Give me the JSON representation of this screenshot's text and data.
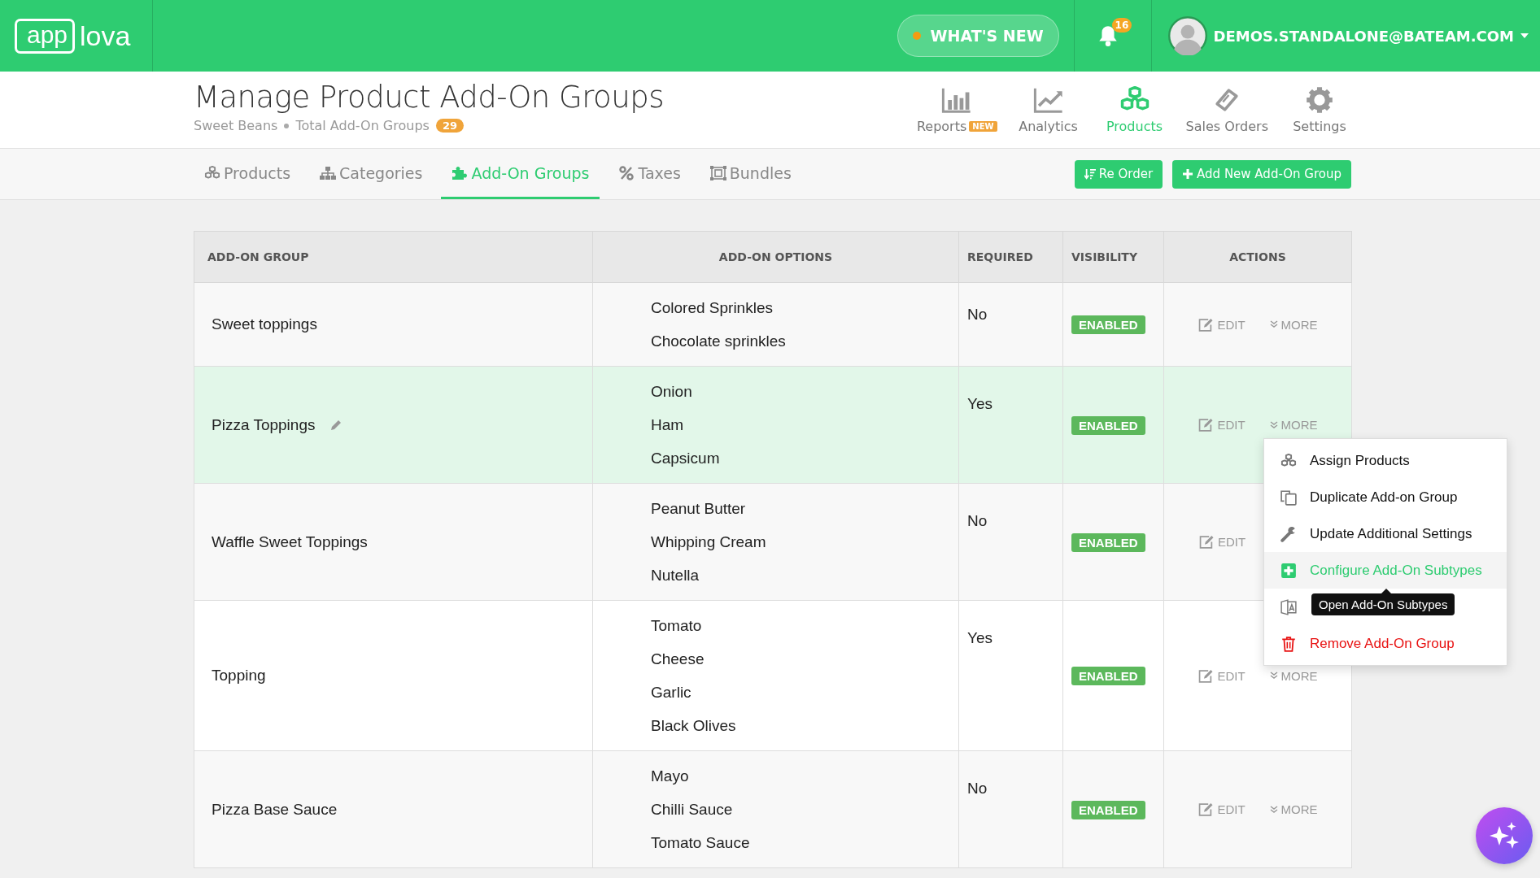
{
  "brand": {
    "left": "app",
    "right": "lova"
  },
  "topbar": {
    "whats_new": "WHAT'S NEW",
    "notifications": "16",
    "user": "DEMOS.STANDALONE@BATEAM.COM"
  },
  "page": {
    "title": "Manage Product Add-On Groups",
    "store": "Sweet Beans",
    "total_label": "Total Add-On Groups",
    "total": "29"
  },
  "modules": [
    {
      "label": "Reports",
      "badge": "NEW",
      "selected": false
    },
    {
      "label": "Analytics",
      "selected": false
    },
    {
      "label": "Products",
      "selected": true
    },
    {
      "label": "Sales Orders",
      "selected": false
    },
    {
      "label": "Settings",
      "selected": false
    }
  ],
  "tabs": [
    {
      "label": "Products",
      "selected": false
    },
    {
      "label": "Categories",
      "selected": false
    },
    {
      "label": "Add-On Groups",
      "selected": true
    },
    {
      "label": "Taxes",
      "selected": false
    },
    {
      "label": "Bundles",
      "selected": false
    }
  ],
  "actions": [
    "Re Order",
    "Add New Add-On Group"
  ],
  "table": {
    "columns": [
      "ADD-ON GROUP",
      "ADD-ON OPTIONS",
      "REQUIRED",
      "VISIBILITY",
      "ACTIONS"
    ],
    "rows": [
      {
        "group": "Sweet toppings",
        "options": [
          "Colored Sprinkles",
          "Chocolate sprinkles"
        ],
        "required": "No",
        "visibility": "ENABLED",
        "edit": "EDIT",
        "more": "MORE",
        "selected": false
      },
      {
        "group": "Pizza Toppings",
        "options": [
          "Onion",
          "Ham",
          "Capsicum"
        ],
        "required": "Yes",
        "visibility": "ENABLED",
        "edit": "EDIT",
        "more": "MORE",
        "selected": true
      },
      {
        "group": "Waffle Sweet Toppings",
        "options": [
          "Peanut Butter",
          "Whipping Cream",
          "Nutella"
        ],
        "required": "No",
        "visibility": "ENABLED",
        "edit": "EDIT",
        "selected": false
      },
      {
        "group": "Topping",
        "options": [
          "Tomato",
          "Cheese",
          "Garlic",
          "Black Olives"
        ],
        "required": "Yes",
        "visibility": "ENABLED",
        "edit": "EDIT",
        "more": "MORE",
        "selected": false
      },
      {
        "group": "Pizza Base Sauce",
        "options": [
          "Mayo",
          "Chilli Sauce",
          "Tomato Sauce"
        ],
        "required": "No",
        "visibility": "ENABLED",
        "edit": "EDIT",
        "more": "MORE",
        "selected": false
      }
    ]
  },
  "more_menu": {
    "items": [
      {
        "label": "Assign Products",
        "kind": "normal"
      },
      {
        "label": "Duplicate Add-on Group",
        "kind": "normal"
      },
      {
        "label": "Update Additional Settings",
        "kind": "normal"
      },
      {
        "label": "Configure Add-On Subtypes",
        "kind": "active"
      },
      {
        "kind": "normal"
      },
      {
        "label": "Remove Add-On Group",
        "kind": "danger"
      }
    ],
    "tooltip": "Open Add-On Subtypes"
  }
}
